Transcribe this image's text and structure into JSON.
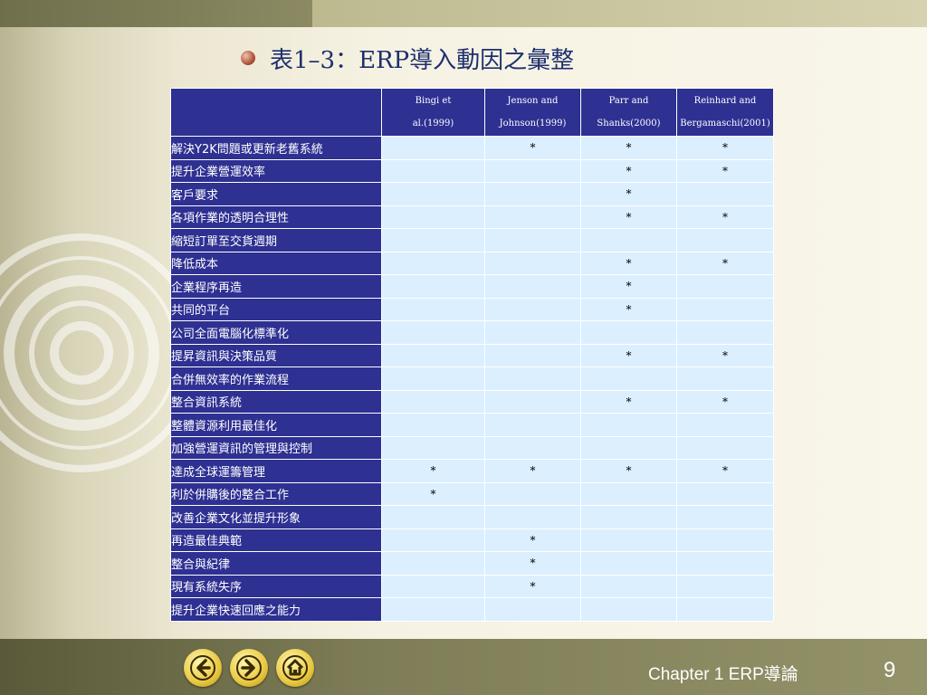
{
  "slide": {
    "title": "表1–3：ERP導入動因之彙整",
    "chapter": "Chapter 1   ERP導論",
    "page_number": "9"
  },
  "table": {
    "headers": [
      {
        "line1": "Bingi et",
        "line2": "al.(1999)"
      },
      {
        "line1": "Jenson and",
        "line2": "Johnson(1999)"
      },
      {
        "line1": "Parr and",
        "line2": "Shanks(2000)"
      },
      {
        "line1": "Reinhard and",
        "line2": "Bergamaschi(2001)"
      }
    ],
    "rows": [
      {
        "label": " 解決Y2K問題或更新老舊系統",
        "marks": [
          "",
          "*",
          "*",
          "*"
        ]
      },
      {
        "label": "提升企業營運效率",
        "marks": [
          "",
          "",
          "*",
          "*"
        ]
      },
      {
        "label": "客戶要求",
        "marks": [
          "",
          "",
          "*",
          ""
        ]
      },
      {
        "label": "各項作業的透明合理性",
        "marks": [
          "",
          "",
          "*",
          "*"
        ]
      },
      {
        "label": "縮短訂單至交貨週期",
        "marks": [
          "",
          "",
          "",
          ""
        ]
      },
      {
        "label": "降低成本",
        "marks": [
          "",
          "",
          "*",
          "*"
        ]
      },
      {
        "label": "企業程序再造",
        "marks": [
          "",
          "",
          "*",
          ""
        ]
      },
      {
        "label": "共同的平台",
        "marks": [
          "",
          "",
          "*",
          ""
        ]
      },
      {
        "label": "公司全面電腦化標準化",
        "marks": [
          "",
          "",
          "",
          ""
        ]
      },
      {
        "label": "提昇資訊與決策品質",
        "marks": [
          "",
          "",
          "*",
          "*"
        ]
      },
      {
        "label": "合併無效率的作業流程",
        "marks": [
          "",
          "",
          "",
          ""
        ]
      },
      {
        "label": "整合資訊系統",
        "marks": [
          "",
          "",
          "*",
          "*"
        ]
      },
      {
        "label": "整體資源利用最佳化",
        "marks": [
          "",
          "",
          "",
          ""
        ]
      },
      {
        "label": "加強營運資訊的管理與控制",
        "marks": [
          "",
          "",
          "",
          ""
        ]
      },
      {
        "label": "達成全球運籌管理",
        "marks": [
          "*",
          "*",
          "*",
          "*"
        ]
      },
      {
        "label": "利於併購後的整合工作",
        "marks": [
          "*",
          "",
          "",
          ""
        ]
      },
      {
        "label": "改善企業文化並提升形象",
        "marks": [
          "",
          "",
          "",
          ""
        ]
      },
      {
        "label": "再造最佳典範",
        "marks": [
          "",
          "*",
          "",
          ""
        ]
      },
      {
        "label": "整合與紀律",
        "marks": [
          "",
          "*",
          "",
          ""
        ]
      },
      {
        "label": "現有系統失序",
        "marks": [
          "",
          "*",
          "",
          ""
        ]
      },
      {
        "label": "提升企業快速回應之能力",
        "marks": [
          "",
          "",
          "",
          ""
        ]
      }
    ]
  },
  "nav": {
    "back_icon": "arrow-left-icon",
    "forward_icon": "arrow-right-icon",
    "home_icon": "home-icon"
  },
  "colors": {
    "header_bg": "#2e3092",
    "cell_bg": "#dcefff",
    "title_color": "#1d2f6e",
    "nav_gold": "#e9c840"
  }
}
